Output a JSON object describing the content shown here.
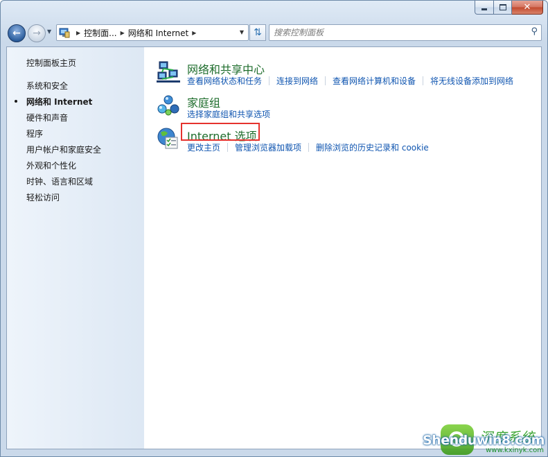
{
  "titlebar": {
    "minimize_icon": "minimize-icon",
    "maximize_icon": "maximize-icon",
    "close_icon": "close-icon"
  },
  "nav": {
    "breadcrumb": [
      "控制面...",
      "网络和 Internet"
    ],
    "search_placeholder": "搜索控制面板"
  },
  "sidebar": {
    "home": "控制面板主页",
    "items": [
      "系统和安全",
      "网络和 Internet",
      "硬件和声音",
      "程序",
      "用户帐户和家庭安全",
      "外观和个性化",
      "时钟、语言和区域",
      "轻松访问"
    ],
    "current_index": 1
  },
  "categories": [
    {
      "title": "网络和共享中心",
      "icon": "network-sharing-icon",
      "links": [
        "查看网络状态和任务",
        "连接到网络",
        "查看网络计算机和设备",
        "将无线设备添加到网络"
      ]
    },
    {
      "title": "家庭组",
      "icon": "homegroup-icon",
      "links": [
        "选择家庭组和共享选项"
      ]
    },
    {
      "title": "Internet 选项",
      "icon": "internet-options-icon",
      "links": [
        "更改主页",
        "管理浏览器加载项",
        "删除浏览的历史记录和 cookie"
      ],
      "highlighted": true
    }
  ],
  "watermark": {
    "brand": "Shenduwin8.com",
    "chinese": "深度系统",
    "url": "www.kxinyk.com"
  },
  "colors": {
    "category_title": "#1e6d2c",
    "link": "#0f55b0",
    "highlight": "#e5322d"
  }
}
